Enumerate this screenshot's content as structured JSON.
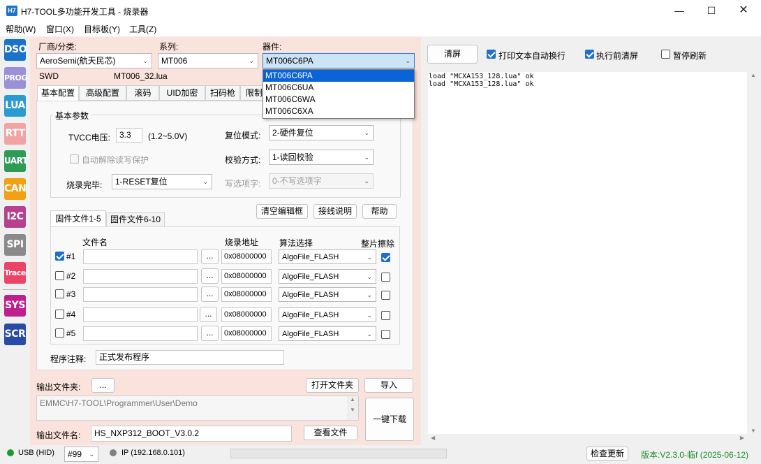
{
  "window": {
    "app_icon": "H7",
    "title": "H7-TOOL多功能开发工具 - 烧录器"
  },
  "menu": [
    "帮助(W)",
    "窗口(X)",
    "目标板(Y)",
    "工具(Z)"
  ],
  "sidebar": [
    {
      "label": "DSO",
      "color": "#1a73c8"
    },
    {
      "label": "PROG",
      "color": "#9a90d6"
    },
    {
      "label": "LUA",
      "color": "#2a9bd1"
    },
    {
      "label": "RTT",
      "color": "#f2a3a3"
    },
    {
      "label": "UART",
      "color": "#2e9b55"
    },
    {
      "label": "CAN",
      "color": "#f2a014"
    },
    {
      "label": "I2C",
      "color": "#b5418f"
    },
    {
      "label": "SPI",
      "color": "#8a8a8a"
    },
    {
      "label": "Trace",
      "color": "#ea4466"
    },
    {
      "label": "SYS",
      "color": "#c0208f"
    },
    {
      "label": "SCR",
      "color": "#2a4aa8"
    }
  ],
  "selectors": {
    "vendor_label": "厂商/分类:",
    "vendor_value": "AeroSemi(航天民芯)",
    "series_label": "系列:",
    "series_value": "MT006",
    "device_label": "器件:",
    "device_value": "MT006C6PA",
    "interface": "SWD",
    "lua_file": "MT006_32.lua"
  },
  "device_dropdown": {
    "options": [
      "MT006C6PA",
      "MT006C6UA",
      "MT006C6WA",
      "MT006C6XA"
    ],
    "selected": 0
  },
  "tabs": [
    "基本配置",
    "高级配置",
    "滚码",
    "UID加密",
    "扫码枪",
    "限制"
  ],
  "basic": {
    "group_title": "基本参数",
    "tvcc_label": "TVCC电压:",
    "tvcc_value": "3.3",
    "tvcc_range": "(1.2~5.0V)",
    "auto_unlock_label": "自动解除读写保护",
    "finish_label": "烧录完毕:",
    "finish_value": "1-RESET复位",
    "reset_label": "复位模式:",
    "reset_value": "2-硬件复位",
    "verify_label": "校验方式:",
    "verify_value": "1-读回校验",
    "option_label": "写选项字:",
    "option_value": "0-不写选项字"
  },
  "actions": {
    "clear_edit": "清空编辑框",
    "wiring": "接线说明",
    "help": "帮助"
  },
  "file_tabs": [
    "固件文件1-5",
    "固件文件6-10"
  ],
  "file_headers": {
    "name": "文件名",
    "addr": "烧录地址",
    "algo": "算法选择",
    "erase": "整片擦除"
  },
  "files": [
    {
      "idx": "#1",
      "checked": true,
      "name": "",
      "browse": "...",
      "addr": "0x08000000",
      "algo": "AlgoFile_FLASH",
      "erase": true
    },
    {
      "idx": "#2",
      "checked": false,
      "name": "",
      "browse": "...",
      "addr": "0x08000000",
      "algo": "AlgoFile_FLASH",
      "erase": false
    },
    {
      "idx": "#3",
      "checked": false,
      "name": "",
      "browse": "...",
      "addr": "0x08000000",
      "algo": "AlgoFile_FLASH",
      "erase": false
    },
    {
      "idx": "#4",
      "checked": false,
      "name": "",
      "browse": "...",
      "addr": "0x08000000",
      "algo": "AlgoFile_FLASH",
      "erase": false
    },
    {
      "idx": "#5",
      "checked": false,
      "name": "",
      "browse": "...",
      "addr": "0x08000000",
      "algo": "AlgoFile_FLASH",
      "erase": false
    }
  ],
  "program_note_label": "程序注释:",
  "program_note": "正式发布程序",
  "output": {
    "folder_label": "输出文件夹:",
    "folder_browse": "...",
    "open_folder": "打开文件夹",
    "import": "导入",
    "path": "EMMC\\H7-TOOL\\Programmer\\User\\Demo",
    "one_click": "一键下载",
    "filename_label": "输出文件名:",
    "filename": "HS_NXP312_BOOT_V3.0.2",
    "view_file": "查看文件"
  },
  "right": {
    "clear_btn": "清屏",
    "opt_wrap": {
      "label": "打印文本自动换行",
      "checked": true
    },
    "opt_clear": {
      "label": "执行前清屏",
      "checked": true
    },
    "opt_pause": {
      "label": "暂停刷新",
      "checked": false
    },
    "log": "load \"MCXA153_128.lua\" ok\nload \"MCXA153_128.lua\" ok"
  },
  "status": {
    "usb": "USB (HID)",
    "usb_color": "#1a9b2e",
    "port": "#99",
    "ip": "IP (192.168.0.101)",
    "ip_color": "#808080",
    "check_update": "检查更新",
    "version": "版本:V2.3.0-临f (2025-06-12)",
    "version_color": "#1a8a2a"
  }
}
